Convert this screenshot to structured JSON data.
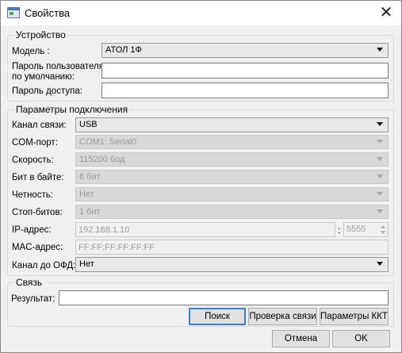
{
  "window": {
    "title": "Свойства",
    "icon": "window-app-icon",
    "close_icon": "close-icon"
  },
  "device": {
    "legend": "Устройство",
    "model_label": "Модель :",
    "model_value": "АТОЛ 1Ф",
    "user_password_label_line1": "Пароль пользователя",
    "user_password_label_line2": "по умолчанию:",
    "user_password_value": "",
    "access_password_label": "Пароль доступа:",
    "access_password_value": ""
  },
  "connection": {
    "legend": "Параметры подключения",
    "channel_label": "Канал связи:",
    "channel_value": "USB",
    "com_label": "COM-порт:",
    "com_value": "COM1: Serial0",
    "speed_label": "Скорость:",
    "speed_value": "115200 бод",
    "bits_label": "Бит в байте:",
    "bits_value": "8 бит",
    "parity_label": "Четность:",
    "parity_value": "Нет",
    "stopbits_label": "Стоп-битов:",
    "stopbits_value": "1 бит",
    "ip_label": "IP-адрес:",
    "ip_value": "192.168.1.10",
    "port_separator": ":",
    "port_value": "5555",
    "mac_label": "MAC-адрес:",
    "mac_value": "FF:FF:FF:FF:FF:FF",
    "ofd_label": "Канал до ОФД:",
    "ofd_value": "Нет"
  },
  "link": {
    "legend": "Связь",
    "result_label": "Результат:",
    "result_value": "",
    "search_button": "Поиск",
    "check_button": "Проверка связи",
    "kkt_params_button": "Параметры ККТ"
  },
  "footer": {
    "cancel_button": "Отмена",
    "ok_button": "OK"
  }
}
